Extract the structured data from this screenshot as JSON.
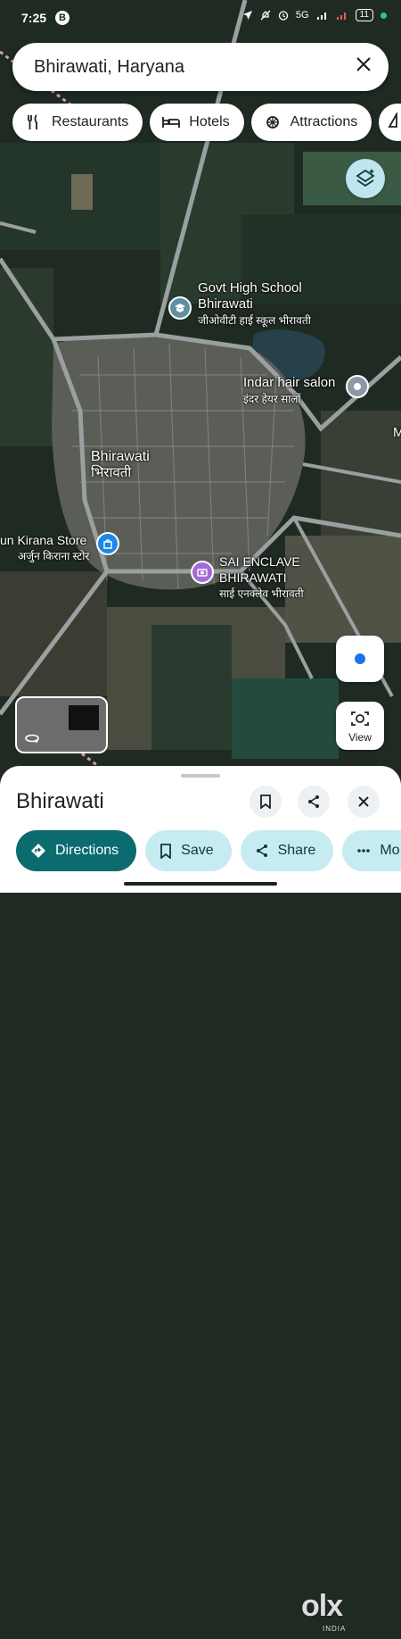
{
  "status_bar": {
    "time": "7:25",
    "badge": "B",
    "signal": "5G",
    "battery": "11"
  },
  "search": {
    "query": "Bhirawati, Haryana"
  },
  "chips": [
    {
      "label": "Restaurants",
      "icon": "fork-knife-icon"
    },
    {
      "label": "Hotels",
      "icon": "bed-icon"
    },
    {
      "label": "Attractions",
      "icon": "attraction-icon"
    }
  ],
  "map_labels": {
    "school_en": "Govt High School Bhirawati",
    "school_hi": "जीओवीटी हाई स्कूल भीरावती",
    "salon_en": "Indar hair salon",
    "salon_hi": "इंदर हेयर सालों",
    "village_en": "Bhirawati",
    "village_hi": "भिरावती",
    "kirana_en": "un Kirana Store",
    "kirana_hi": "अर्जुन किराना स्टोर",
    "enclave_en": "SAI ENCLAVE BHIRAWATI",
    "enclave_hi": "साई एनक्लेव भीरावती",
    "edge": "M"
  },
  "controls": {
    "view_label": "View"
  },
  "sheet": {
    "title": "Bhirawati",
    "directions": "Directions",
    "save": "Save",
    "share": "Share",
    "more": "Mo"
  },
  "colors": {
    "accent": "#0b6b6f",
    "secondary": "#c6ecf1",
    "location": "#1a73e8",
    "pin_school": "#5f8fa0",
    "pin_kirana": "#1e88e5",
    "pin_enclave": "#a46ad6"
  }
}
